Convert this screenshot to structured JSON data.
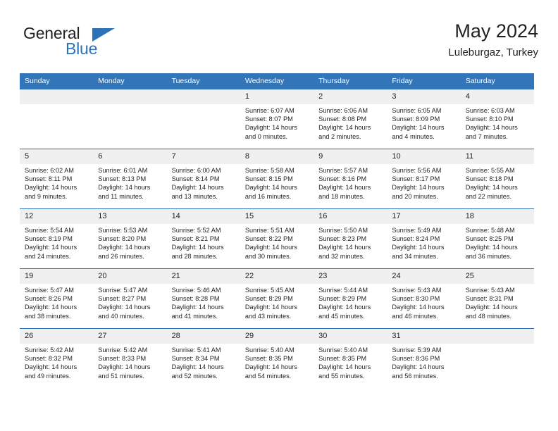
{
  "brand": {
    "name_top": "General",
    "name_bottom": "Blue",
    "triangle_icon": "triangle-icon",
    "accent_color": "#2a73b8"
  },
  "header": {
    "title": "May 2024",
    "subtitle": "Luleburgaz, Turkey"
  },
  "theme": {
    "header_blue": "#3275b8",
    "row_border_blue": "#2a6db0",
    "daynum_band": "#f0f0f0",
    "text": "#231f20"
  },
  "weekdays": [
    "Sunday",
    "Monday",
    "Tuesday",
    "Wednesday",
    "Thursday",
    "Friday",
    "Saturday"
  ],
  "weeks": [
    [
      {
        "day": "",
        "blank": true,
        "sunrise": "",
        "sunset": "",
        "daylight_line1": "",
        "daylight_line2": ""
      },
      {
        "day": "",
        "blank": true,
        "sunrise": "",
        "sunset": "",
        "daylight_line1": "",
        "daylight_line2": ""
      },
      {
        "day": "",
        "blank": true,
        "sunrise": "",
        "sunset": "",
        "daylight_line1": "",
        "daylight_line2": ""
      },
      {
        "day": "1",
        "blank": false,
        "sunrise": "Sunrise: 6:07 AM",
        "sunset": "Sunset: 8:07 PM",
        "daylight_line1": "Daylight: 14 hours",
        "daylight_line2": "and 0 minutes."
      },
      {
        "day": "2",
        "blank": false,
        "sunrise": "Sunrise: 6:06 AM",
        "sunset": "Sunset: 8:08 PM",
        "daylight_line1": "Daylight: 14 hours",
        "daylight_line2": "and 2 minutes."
      },
      {
        "day": "3",
        "blank": false,
        "sunrise": "Sunrise: 6:05 AM",
        "sunset": "Sunset: 8:09 PM",
        "daylight_line1": "Daylight: 14 hours",
        "daylight_line2": "and 4 minutes."
      },
      {
        "day": "4",
        "blank": false,
        "sunrise": "Sunrise: 6:03 AM",
        "sunset": "Sunset: 8:10 PM",
        "daylight_line1": "Daylight: 14 hours",
        "daylight_line2": "and 7 minutes."
      }
    ],
    [
      {
        "day": "5",
        "blank": false,
        "sunrise": "Sunrise: 6:02 AM",
        "sunset": "Sunset: 8:11 PM",
        "daylight_line1": "Daylight: 14 hours",
        "daylight_line2": "and 9 minutes."
      },
      {
        "day": "6",
        "blank": false,
        "sunrise": "Sunrise: 6:01 AM",
        "sunset": "Sunset: 8:13 PM",
        "daylight_line1": "Daylight: 14 hours",
        "daylight_line2": "and 11 minutes."
      },
      {
        "day": "7",
        "blank": false,
        "sunrise": "Sunrise: 6:00 AM",
        "sunset": "Sunset: 8:14 PM",
        "daylight_line1": "Daylight: 14 hours",
        "daylight_line2": "and 13 minutes."
      },
      {
        "day": "8",
        "blank": false,
        "sunrise": "Sunrise: 5:58 AM",
        "sunset": "Sunset: 8:15 PM",
        "daylight_line1": "Daylight: 14 hours",
        "daylight_line2": "and 16 minutes."
      },
      {
        "day": "9",
        "blank": false,
        "sunrise": "Sunrise: 5:57 AM",
        "sunset": "Sunset: 8:16 PM",
        "daylight_line1": "Daylight: 14 hours",
        "daylight_line2": "and 18 minutes."
      },
      {
        "day": "10",
        "blank": false,
        "sunrise": "Sunrise: 5:56 AM",
        "sunset": "Sunset: 8:17 PM",
        "daylight_line1": "Daylight: 14 hours",
        "daylight_line2": "and 20 minutes."
      },
      {
        "day": "11",
        "blank": false,
        "sunrise": "Sunrise: 5:55 AM",
        "sunset": "Sunset: 8:18 PM",
        "daylight_line1": "Daylight: 14 hours",
        "daylight_line2": "and 22 minutes."
      }
    ],
    [
      {
        "day": "12",
        "blank": false,
        "sunrise": "Sunrise: 5:54 AM",
        "sunset": "Sunset: 8:19 PM",
        "daylight_line1": "Daylight: 14 hours",
        "daylight_line2": "and 24 minutes."
      },
      {
        "day": "13",
        "blank": false,
        "sunrise": "Sunrise: 5:53 AM",
        "sunset": "Sunset: 8:20 PM",
        "daylight_line1": "Daylight: 14 hours",
        "daylight_line2": "and 26 minutes."
      },
      {
        "day": "14",
        "blank": false,
        "sunrise": "Sunrise: 5:52 AM",
        "sunset": "Sunset: 8:21 PM",
        "daylight_line1": "Daylight: 14 hours",
        "daylight_line2": "and 28 minutes."
      },
      {
        "day": "15",
        "blank": false,
        "sunrise": "Sunrise: 5:51 AM",
        "sunset": "Sunset: 8:22 PM",
        "daylight_line1": "Daylight: 14 hours",
        "daylight_line2": "and 30 minutes."
      },
      {
        "day": "16",
        "blank": false,
        "sunrise": "Sunrise: 5:50 AM",
        "sunset": "Sunset: 8:23 PM",
        "daylight_line1": "Daylight: 14 hours",
        "daylight_line2": "and 32 minutes."
      },
      {
        "day": "17",
        "blank": false,
        "sunrise": "Sunrise: 5:49 AM",
        "sunset": "Sunset: 8:24 PM",
        "daylight_line1": "Daylight: 14 hours",
        "daylight_line2": "and 34 minutes."
      },
      {
        "day": "18",
        "blank": false,
        "sunrise": "Sunrise: 5:48 AM",
        "sunset": "Sunset: 8:25 PM",
        "daylight_line1": "Daylight: 14 hours",
        "daylight_line2": "and 36 minutes."
      }
    ],
    [
      {
        "day": "19",
        "blank": false,
        "sunrise": "Sunrise: 5:47 AM",
        "sunset": "Sunset: 8:26 PM",
        "daylight_line1": "Daylight: 14 hours",
        "daylight_line2": "and 38 minutes."
      },
      {
        "day": "20",
        "blank": false,
        "sunrise": "Sunrise: 5:47 AM",
        "sunset": "Sunset: 8:27 PM",
        "daylight_line1": "Daylight: 14 hours",
        "daylight_line2": "and 40 minutes."
      },
      {
        "day": "21",
        "blank": false,
        "sunrise": "Sunrise: 5:46 AM",
        "sunset": "Sunset: 8:28 PM",
        "daylight_line1": "Daylight: 14 hours",
        "daylight_line2": "and 41 minutes."
      },
      {
        "day": "22",
        "blank": false,
        "sunrise": "Sunrise: 5:45 AM",
        "sunset": "Sunset: 8:29 PM",
        "daylight_line1": "Daylight: 14 hours",
        "daylight_line2": "and 43 minutes."
      },
      {
        "day": "23",
        "blank": false,
        "sunrise": "Sunrise: 5:44 AM",
        "sunset": "Sunset: 8:29 PM",
        "daylight_line1": "Daylight: 14 hours",
        "daylight_line2": "and 45 minutes."
      },
      {
        "day": "24",
        "blank": false,
        "sunrise": "Sunrise: 5:43 AM",
        "sunset": "Sunset: 8:30 PM",
        "daylight_line1": "Daylight: 14 hours",
        "daylight_line2": "and 46 minutes."
      },
      {
        "day": "25",
        "blank": false,
        "sunrise": "Sunrise: 5:43 AM",
        "sunset": "Sunset: 8:31 PM",
        "daylight_line1": "Daylight: 14 hours",
        "daylight_line2": "and 48 minutes."
      }
    ],
    [
      {
        "day": "26",
        "blank": false,
        "sunrise": "Sunrise: 5:42 AM",
        "sunset": "Sunset: 8:32 PM",
        "daylight_line1": "Daylight: 14 hours",
        "daylight_line2": "and 49 minutes."
      },
      {
        "day": "27",
        "blank": false,
        "sunrise": "Sunrise: 5:42 AM",
        "sunset": "Sunset: 8:33 PM",
        "daylight_line1": "Daylight: 14 hours",
        "daylight_line2": "and 51 minutes."
      },
      {
        "day": "28",
        "blank": false,
        "sunrise": "Sunrise: 5:41 AM",
        "sunset": "Sunset: 8:34 PM",
        "daylight_line1": "Daylight: 14 hours",
        "daylight_line2": "and 52 minutes."
      },
      {
        "day": "29",
        "blank": false,
        "sunrise": "Sunrise: 5:40 AM",
        "sunset": "Sunset: 8:35 PM",
        "daylight_line1": "Daylight: 14 hours",
        "daylight_line2": "and 54 minutes."
      },
      {
        "day": "30",
        "blank": false,
        "sunrise": "Sunrise: 5:40 AM",
        "sunset": "Sunset: 8:35 PM",
        "daylight_line1": "Daylight: 14 hours",
        "daylight_line2": "and 55 minutes."
      },
      {
        "day": "31",
        "blank": false,
        "sunrise": "Sunrise: 5:39 AM",
        "sunset": "Sunset: 8:36 PM",
        "daylight_line1": "Daylight: 14 hours",
        "daylight_line2": "and 56 minutes."
      },
      {
        "day": "",
        "blank": true,
        "sunrise": "",
        "sunset": "",
        "daylight_line1": "",
        "daylight_line2": ""
      }
    ]
  ]
}
